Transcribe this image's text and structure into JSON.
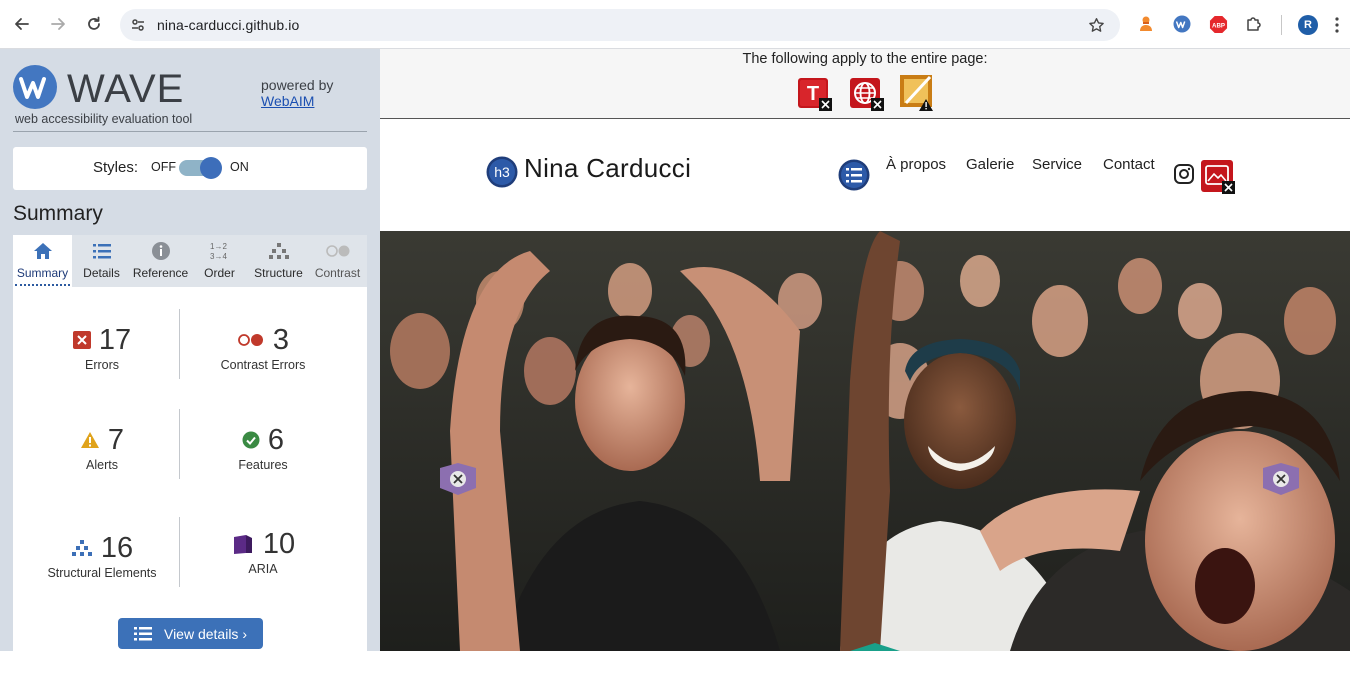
{
  "browser": {
    "url": "nina-carducci.github.io",
    "profile_initial": "R",
    "extensions": [
      "person-extension-icon",
      "wave-extension-icon",
      "adblock-plus-icon",
      "puzzle-extensions-icon"
    ]
  },
  "wave": {
    "logo_text": "WAVE",
    "tagline": "web accessibility evaluation tool",
    "powered_by": "powered by",
    "powered_link": "WebAIM",
    "styles_label": "Styles:",
    "styles_off": "OFF",
    "styles_on": "ON",
    "styles_enabled": true,
    "summary_title": "Summary",
    "tabs": [
      {
        "label": "Summary",
        "active": true
      },
      {
        "label": "Details",
        "active": false
      },
      {
        "label": "Reference",
        "active": false
      },
      {
        "label": "Order",
        "active": false
      },
      {
        "label": "Structure",
        "active": false
      },
      {
        "label": "Contrast",
        "active": false
      }
    ],
    "stats": {
      "errors": {
        "count": "17",
        "label": "Errors"
      },
      "contrast": {
        "count": "3",
        "label": "Contrast Errors"
      },
      "alerts": {
        "count": "7",
        "label": "Alerts"
      },
      "features": {
        "count": "6",
        "label": "Features"
      },
      "structural": {
        "count": "16",
        "label": "Structural Elements"
      },
      "aria": {
        "count": "10",
        "label": "ARIA"
      }
    },
    "view_details": "View details ›",
    "colors": {
      "error": "#c0392b",
      "alert": "#e0a31b",
      "feature": "#3a8a43",
      "structural": "#3c6fb7",
      "aria": "#5b2a86",
      "accent": "#3c71b8"
    }
  },
  "page": {
    "notice": "The following apply to the entire page:",
    "site_title": "Nina Carducci",
    "heading_badge": "h3",
    "nav": [
      "À propos",
      "Galerie",
      "Service",
      "Contact"
    ]
  }
}
